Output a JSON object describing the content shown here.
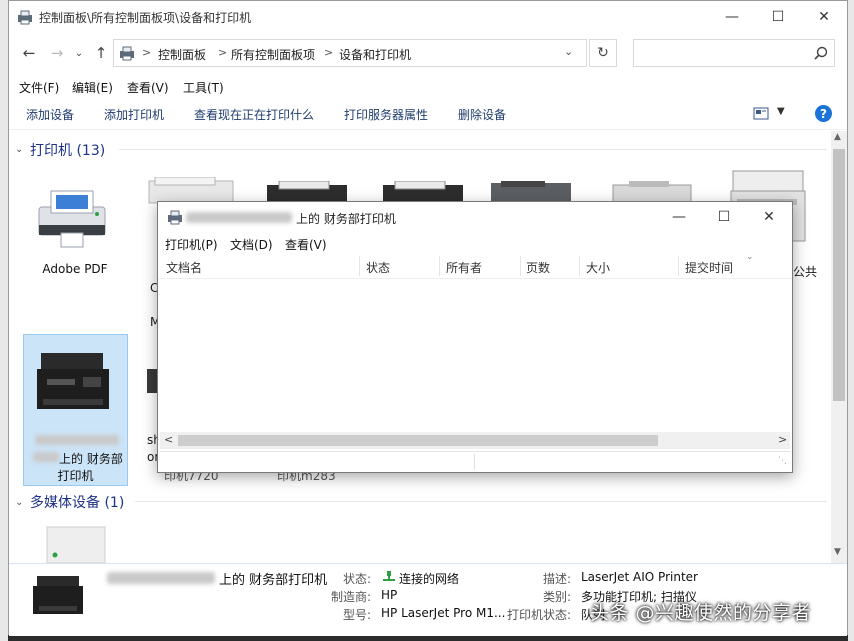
{
  "window": {
    "title": "控制面板\\所有控制面板项\\设备和打印机"
  },
  "address": {
    "crumbs": [
      "控制面板",
      "所有控制面板项",
      "设备和打印机"
    ]
  },
  "menu": [
    "文件(F)",
    "编辑(E)",
    "查看(V)",
    "工具(T)"
  ],
  "toolbar": [
    "添加设备",
    "添加打印机",
    "查看现在正在打印什么",
    "打印服务器属性",
    "删除设备"
  ],
  "groups": {
    "printers": "打印机 (13)",
    "media": "多媒体设备 (1)"
  },
  "devices": {
    "adobe_pdf": "Adobe PDF",
    "partial_c": "C",
    "partial_m": "M",
    "partial_gong": "公共",
    "selected_line1": "上的 财务部",
    "selected_line2": "打印机",
    "partial_sh": "sh",
    "partial_or": "or",
    "partial_7720": "印机7720",
    "partial_m283": "印机m283"
  },
  "queue": {
    "title": "上的 财务部打印机",
    "menu": [
      "打印机(P)",
      "文档(D)",
      "查看(V)"
    ],
    "columns": [
      "文档名",
      "状态",
      "所有者",
      "页数",
      "大小",
      "提交时间"
    ]
  },
  "details": {
    "name": "上的 财务部打印机",
    "status_label": "状态:",
    "status_value": "连接的网络",
    "maker_label": "制造商:",
    "maker_value": "HP",
    "model_label": "型号:",
    "model_value": "HP LaserJet Pro M1...",
    "desc_label": "描述:",
    "desc_value": "LaserJet AIO Printer",
    "category_label": "类别:",
    "category_value": "多功能打印机; 扫描仪",
    "printer_status_label": "打印机状态:",
    "printer_status_value": "队列"
  },
  "watermark": "头条 @兴趣使然的分享者",
  "colors": {
    "group_header": "#1e3287",
    "toolbar_text": "#1e3c6e",
    "help_button": "#1a73d6",
    "selection": "#cce4f7"
  }
}
